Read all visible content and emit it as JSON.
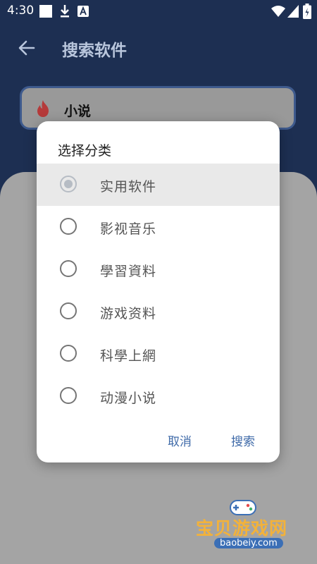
{
  "statusbar": {
    "time": "4:30"
  },
  "appbar": {
    "title": "搜索软件"
  },
  "search": {
    "value": "小说"
  },
  "dialog": {
    "title": "选择分类",
    "options": [
      {
        "label": "实用软件",
        "selected": true
      },
      {
        "label": "影视音乐",
        "selected": false
      },
      {
        "label": "學習資料",
        "selected": false
      },
      {
        "label": "游戏资料",
        "selected": false
      },
      {
        "label": "科學上網",
        "selected": false
      },
      {
        "label": "动漫小说",
        "selected": false
      }
    ],
    "cancel_label": "取消",
    "search_label": "搜索"
  },
  "watermark": {
    "text": "宝贝游戏网",
    "url": "baobeiy.com"
  },
  "colors": {
    "appbar": "#1d2f52",
    "accent": "#3f6aa8",
    "flame": "#b53a3a"
  },
  "icons": [
    "download-icon",
    "notification-a-icon",
    "wifi-icon",
    "signal-icon",
    "battery-icon",
    "back-arrow-icon",
    "flame-icon"
  ]
}
